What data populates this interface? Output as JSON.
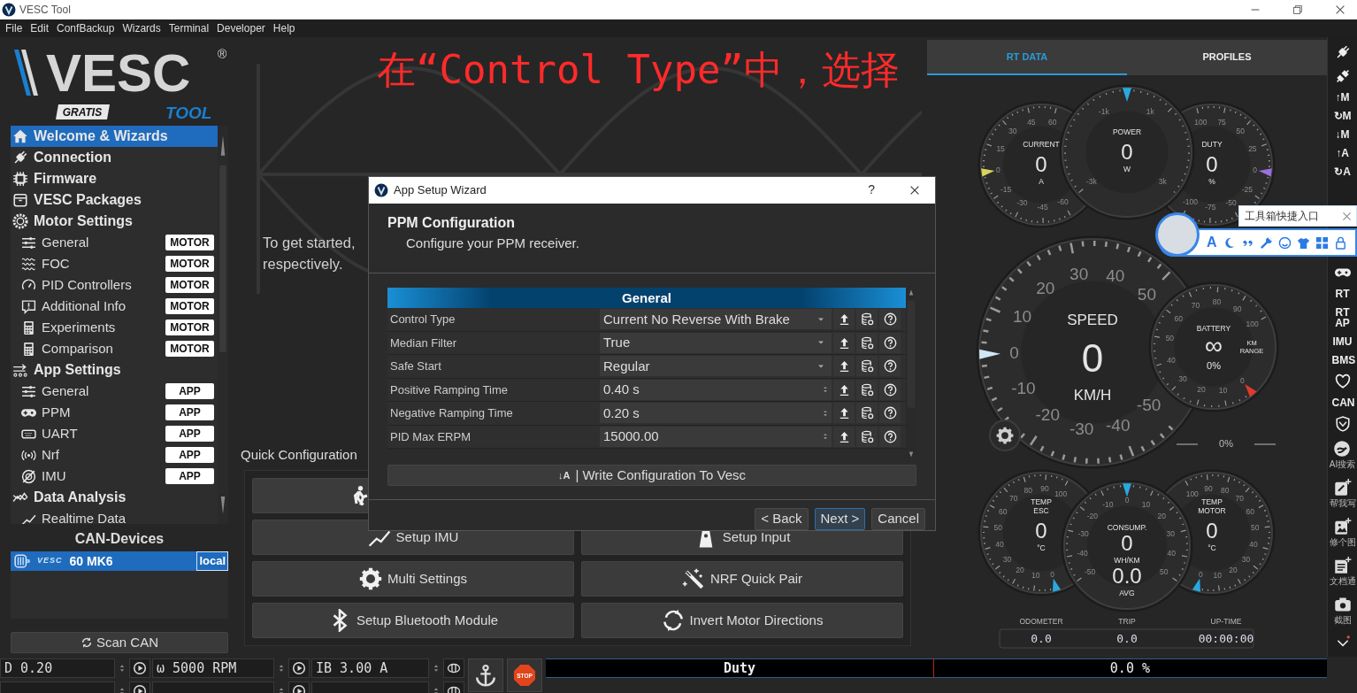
{
  "window": {
    "title": "VESC Tool"
  },
  "menu": [
    "File",
    "Edit",
    "ConfBackup",
    "Wizards",
    "Terminal",
    "Developer",
    "Help"
  ],
  "logo": {
    "wordmark": "VESC",
    "registered": "®",
    "badge": "GRATIS",
    "subtitle": "TOOL"
  },
  "nav": [
    {
      "label": "Welcome & Wizards",
      "selected": true
    },
    {
      "label": "Connection",
      "selected": false
    },
    {
      "label": "Firmware",
      "selected": false
    },
    {
      "label": "VESC Packages",
      "selected": false
    },
    {
      "label": "Motor Settings",
      "selected": false,
      "children": [
        {
          "label": "General",
          "badge": "MOTOR",
          "selected": false
        },
        {
          "label": "FOC",
          "badge": "MOTOR",
          "selected": false
        },
        {
          "label": "PID Controllers",
          "badge": "MOTOR",
          "selected": false
        },
        {
          "label": "Additional Info",
          "badge": "MOTOR",
          "selected": false
        },
        {
          "label": "Experiments",
          "badge": "MOTOR",
          "selected": false
        },
        {
          "label": "Comparison",
          "badge": "MOTOR",
          "selected": false
        }
      ]
    },
    {
      "label": "App Settings",
      "selected": false,
      "children": [
        {
          "label": "General",
          "badge": "APP",
          "selected": false
        },
        {
          "label": "PPM",
          "badge": "APP",
          "selected": false
        },
        {
          "label": "UART",
          "badge": "APP",
          "selected": false
        },
        {
          "label": "Nrf",
          "badge": "APP",
          "selected": false
        },
        {
          "label": "IMU",
          "badge": "APP",
          "selected": false
        }
      ]
    },
    {
      "label": "Data Analysis",
      "selected": false,
      "children": [
        {
          "label": "Realtime Data",
          "selected": false
        }
      ]
    }
  ],
  "can_devices": {
    "title": "CAN-Devices",
    "devices": [
      {
        "brand": "VESC",
        "name": "60 MK6",
        "tag": "local",
        "selected": true
      }
    ],
    "scan_button": "Scan CAN"
  },
  "welcome": {
    "lines": [
      "To get started,",
      "respectively."
    ]
  },
  "annotation": "在“Control Type”中，选择",
  "quick_config": {
    "title": "Quick Configuration",
    "buttons": [
      {
        "kind": "icon-only"
      },
      {
        "kind": "labeled",
        "label": "Setup IMU"
      },
      {
        "kind": "labeled",
        "label": "Setup Input"
      },
      {
        "kind": "labeled",
        "label": "Multi Settings"
      },
      {
        "kind": "labeled",
        "label": "NRF Quick Pair"
      },
      {
        "kind": "labeled",
        "label": "Setup Bluetooth Module"
      },
      {
        "kind": "labeled",
        "label": "Invert Motor Directions"
      }
    ]
  },
  "dialog": {
    "title": "App Setup Wizard",
    "help": "?",
    "heading": "PPM Configuration",
    "subheading": "Configure your PPM receiver.",
    "section": "General",
    "params": [
      {
        "label": "Control Type",
        "value": "Current No Reverse With Brake",
        "kind": "combo"
      },
      {
        "label": "Median Filter",
        "value": "True",
        "kind": "combo"
      },
      {
        "label": "Safe Start",
        "value": "Regular",
        "kind": "combo"
      },
      {
        "label": "Positive Ramping Time",
        "value": "0.40 s",
        "kind": "spin"
      },
      {
        "label": "Negative Ramping Time",
        "value": "0.20 s",
        "kind": "spin"
      },
      {
        "label": "PID Max ERPM",
        "value": "15000.00",
        "kind": "spin"
      }
    ],
    "write_button": {
      "glyph": "↓A",
      "label": "| Write Configuration To Vesc"
    },
    "buttons": [
      {
        "label": "< Back",
        "focused": false
      },
      {
        "label": "Next >",
        "focused": true
      },
      {
        "label": "Cancel",
        "focused": false
      }
    ]
  },
  "rt_panel": {
    "tabs": [
      {
        "label": "RT DATA",
        "selected": true
      },
      {
        "label": "PROFILES",
        "selected": false
      }
    ],
    "gauges": [
      {
        "kind": "current",
        "title": [
          "CURRENT"
        ],
        "value": "0",
        "unit": "A",
        "color": "#d8d45a",
        "ticks": [
          "60",
          "45",
          "30",
          "15",
          "0",
          "-15",
          "-30",
          "-45",
          "-60"
        ]
      },
      {
        "kind": "power",
        "title": [
          "POWER"
        ],
        "value": "0",
        "unit": "W",
        "color": "#2aa8e0",
        "ticks": [
          "-1k",
          "1k",
          "-3k",
          "3k"
        ]
      },
      {
        "kind": "duty",
        "title": [
          "DUTY"
        ],
        "value": "0",
        "unit": "%",
        "color": "#9b6fe0",
        "ticks": [
          "100",
          "75",
          "50",
          "25",
          "0",
          "-25",
          "-50",
          "-75",
          "-100"
        ]
      },
      {
        "kind": "speed",
        "title": [
          "SPEED"
        ],
        "value": "0",
        "unit": "KM/H",
        "color": "#cfe8f5",
        "ticks": [
          "50",
          "40",
          "30",
          "20",
          "10",
          "0",
          "-10",
          "-20",
          "-30",
          "-40",
          "-50"
        ]
      },
      {
        "kind": "battery",
        "title": [
          "BATTERY"
        ],
        "value": "∞",
        "sub_value": "0%",
        "side_label": [
          "KM",
          "RANGE"
        ],
        "color": "#e0392e",
        "ticks": [
          "100",
          "90",
          "80",
          "70",
          "60",
          "50",
          "40",
          "30",
          "20",
          "10",
          "0"
        ]
      },
      {
        "kind": "temp-esc",
        "title": [
          "TEMP",
          "ESC"
        ],
        "value": "0",
        "unit": "°C",
        "color": "#2aa8e0",
        "ticks": [
          "100",
          "90",
          "80",
          "70",
          "60",
          "50",
          "40",
          "30",
          "20",
          "10",
          "0"
        ]
      },
      {
        "kind": "consump",
        "title": [
          "CONSUMP."
        ],
        "value": "0",
        "unit": "WH/KM",
        "sub_value": "0.0",
        "sub_unit": "AVG",
        "color": "#2aa8e0",
        "ticks": [
          "-50",
          "-40",
          "-30",
          "-20",
          "-10",
          "0",
          "10",
          "20",
          "30",
          "40",
          "50"
        ]
      },
      {
        "kind": "temp-motor",
        "title": [
          "TEMP",
          "MOTOR"
        ],
        "value": "0",
        "unit": "°C",
        "color": "#2aa8e0",
        "ticks": [
          "100",
          "90",
          "80",
          "70",
          "60",
          "50",
          "40",
          "30",
          "20",
          "10",
          "0"
        ]
      }
    ],
    "progress": "0%",
    "stats": [
      {
        "label": "ODOMETER",
        "value": "0.0"
      },
      {
        "label": "TRIP",
        "value": "0.0"
      },
      {
        "label": "UP-TIME",
        "value": "00:00:00"
      }
    ]
  },
  "toolbar": [
    {
      "kind": "icon"
    },
    {
      "kind": "icon"
    },
    {
      "kind": "text",
      "label": "↑M"
    },
    {
      "kind": "text",
      "label": "↻M"
    },
    {
      "kind": "text",
      "label": "↓M"
    },
    {
      "kind": "text",
      "label": "↑A"
    },
    {
      "kind": "text",
      "label": "↻A"
    },
    {
      "kind": "icon"
    },
    {
      "kind": "text",
      "label": "RT"
    },
    {
      "kind": "text",
      "label": "RT AP"
    },
    {
      "kind": "text",
      "label": "IMU"
    },
    {
      "kind": "text",
      "label": "BMS"
    },
    {
      "kind": "icon"
    },
    {
      "kind": "text",
      "label": "CAN"
    },
    {
      "kind": "icon"
    },
    {
      "kind": "captioned",
      "caption": "AI搜索"
    },
    {
      "kind": "captioned",
      "caption": "帮我写"
    },
    {
      "kind": "captioned",
      "caption": "修个图"
    },
    {
      "kind": "captioned",
      "caption": "文档通"
    },
    {
      "kind": "captioned",
      "caption": "截图"
    },
    {
      "kind": "icon"
    }
  ],
  "popup": {
    "label": "工具箱快捷入口",
    "tools": [
      {
        "kind": "text",
        "label": "A"
      },
      {
        "kind": "icon"
      },
      {
        "kind": "icon"
      },
      {
        "kind": "icon"
      },
      {
        "kind": "icon"
      },
      {
        "kind": "icon"
      },
      {
        "kind": "icon"
      },
      {
        "kind": "icon"
      }
    ]
  },
  "bottom": {
    "fields": [
      {
        "value": "D 0.20"
      },
      {
        "value": "ω 5000 RPM"
      },
      {
        "value": "IB 3.00 A"
      }
    ],
    "stop": "STOP",
    "bar": {
      "label": "Duty",
      "reading": "0.0 %"
    }
  }
}
